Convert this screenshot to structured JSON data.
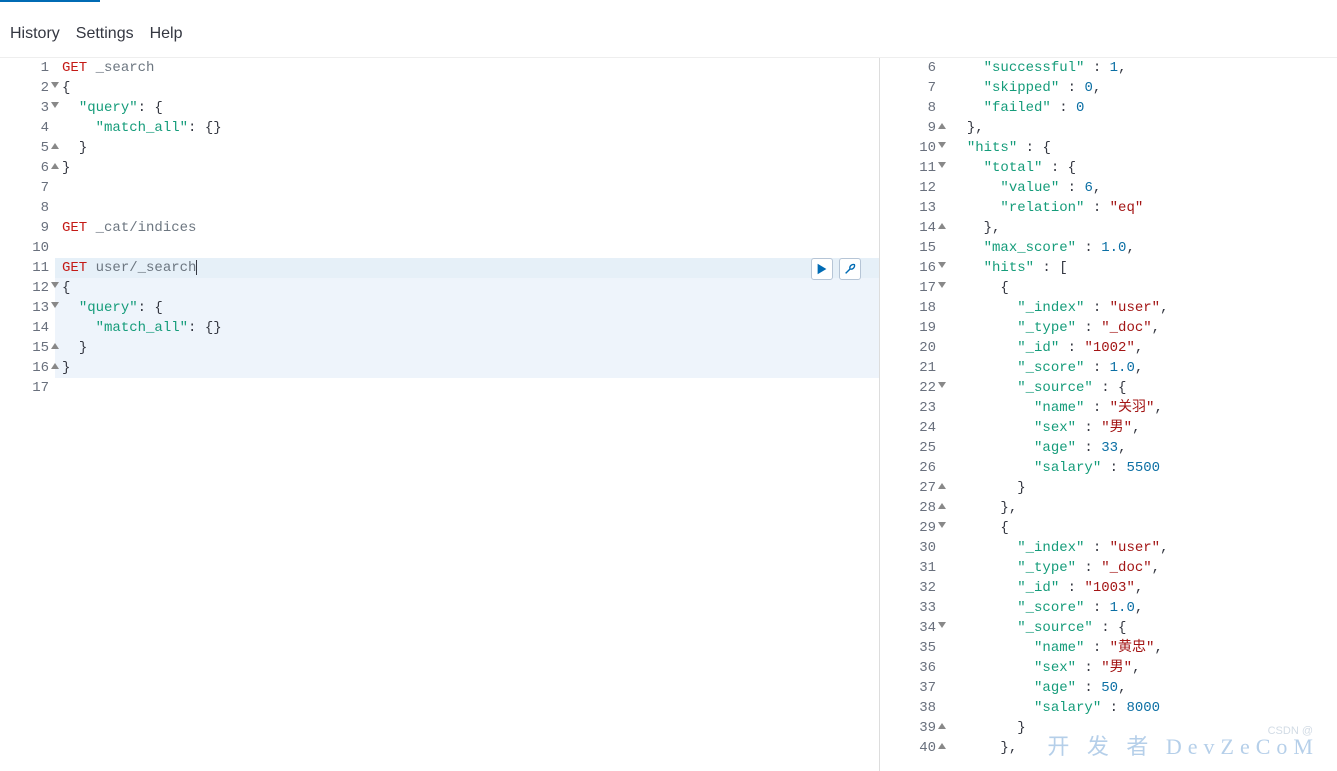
{
  "menubar": {
    "history": "History",
    "settings": "Settings",
    "help": "Help"
  },
  "editor": {
    "lines": [
      {
        "n": 1,
        "fold": "",
        "tokens": [
          [
            "method",
            "GET"
          ],
          [
            "plain",
            " "
          ],
          [
            "path",
            "_search"
          ]
        ]
      },
      {
        "n": 2,
        "fold": "open",
        "tokens": [
          [
            "punc",
            "{"
          ]
        ]
      },
      {
        "n": 3,
        "fold": "open",
        "tokens": [
          [
            "plain",
            "  "
          ],
          [
            "key",
            "\"query\""
          ],
          [
            "punc",
            ": {"
          ]
        ]
      },
      {
        "n": 4,
        "fold": "",
        "tokens": [
          [
            "plain",
            "    "
          ],
          [
            "key",
            "\"match_all\""
          ],
          [
            "punc",
            ": {}"
          ]
        ]
      },
      {
        "n": 5,
        "fold": "close",
        "tokens": [
          [
            "plain",
            "  "
          ],
          [
            "punc",
            "}"
          ]
        ]
      },
      {
        "n": 6,
        "fold": "close",
        "tokens": [
          [
            "punc",
            "}"
          ]
        ]
      },
      {
        "n": 7,
        "fold": "",
        "tokens": []
      },
      {
        "n": 8,
        "fold": "",
        "tokens": []
      },
      {
        "n": 9,
        "fold": "",
        "tokens": [
          [
            "method",
            "GET"
          ],
          [
            "plain",
            " "
          ],
          [
            "path",
            "_cat/indices"
          ]
        ]
      },
      {
        "n": 10,
        "fold": "",
        "tokens": []
      },
      {
        "n": 11,
        "fold": "",
        "tokens": [
          [
            "method",
            "GET"
          ],
          [
            "plain",
            " "
          ],
          [
            "path",
            "user/_search"
          ]
        ],
        "active": true,
        "cursor": true
      },
      {
        "n": 12,
        "fold": "open",
        "tokens": [
          [
            "punc",
            "{"
          ]
        ],
        "block": true
      },
      {
        "n": 13,
        "fold": "open",
        "tokens": [
          [
            "plain",
            "  "
          ],
          [
            "key",
            "\"query\""
          ],
          [
            "punc",
            ": {"
          ]
        ],
        "block": true
      },
      {
        "n": 14,
        "fold": "",
        "tokens": [
          [
            "plain",
            "    "
          ],
          [
            "key",
            "\"match_all\""
          ],
          [
            "punc",
            ": {}"
          ]
        ],
        "block": true
      },
      {
        "n": 15,
        "fold": "close",
        "tokens": [
          [
            "plain",
            "  "
          ],
          [
            "punc",
            "}"
          ]
        ],
        "block": true
      },
      {
        "n": 16,
        "fold": "close",
        "tokens": [
          [
            "punc",
            "}"
          ]
        ],
        "block": true
      },
      {
        "n": 17,
        "fold": "",
        "tokens": []
      }
    ]
  },
  "response": {
    "lines": [
      {
        "n": 6,
        "fold": "",
        "tokens": [
          [
            "plain",
            "    "
          ],
          [
            "key",
            "\"successful\""
          ],
          [
            "punc",
            " : "
          ],
          [
            "num",
            "1"
          ],
          [
            "punc",
            ","
          ]
        ]
      },
      {
        "n": 7,
        "fold": "",
        "tokens": [
          [
            "plain",
            "    "
          ],
          [
            "key",
            "\"skipped\""
          ],
          [
            "punc",
            " : "
          ],
          [
            "num",
            "0"
          ],
          [
            "punc",
            ","
          ]
        ]
      },
      {
        "n": 8,
        "fold": "",
        "tokens": [
          [
            "plain",
            "    "
          ],
          [
            "key",
            "\"failed\""
          ],
          [
            "punc",
            " : "
          ],
          [
            "num",
            "0"
          ]
        ]
      },
      {
        "n": 9,
        "fold": "close",
        "tokens": [
          [
            "plain",
            "  "
          ],
          [
            "punc",
            "},"
          ]
        ]
      },
      {
        "n": 10,
        "fold": "open",
        "tokens": [
          [
            "plain",
            "  "
          ],
          [
            "key",
            "\"hits\""
          ],
          [
            "punc",
            " : {"
          ]
        ]
      },
      {
        "n": 11,
        "fold": "open",
        "tokens": [
          [
            "plain",
            "    "
          ],
          [
            "key",
            "\"total\""
          ],
          [
            "punc",
            " : {"
          ]
        ]
      },
      {
        "n": 12,
        "fold": "",
        "tokens": [
          [
            "plain",
            "      "
          ],
          [
            "key",
            "\"value\""
          ],
          [
            "punc",
            " : "
          ],
          [
            "num",
            "6"
          ],
          [
            "punc",
            ","
          ]
        ]
      },
      {
        "n": 13,
        "fold": "",
        "tokens": [
          [
            "plain",
            "      "
          ],
          [
            "key",
            "\"relation\""
          ],
          [
            "punc",
            " : "
          ],
          [
            "str",
            "\"eq\""
          ]
        ]
      },
      {
        "n": 14,
        "fold": "close",
        "tokens": [
          [
            "plain",
            "    "
          ],
          [
            "punc",
            "},"
          ]
        ]
      },
      {
        "n": 15,
        "fold": "",
        "tokens": [
          [
            "plain",
            "    "
          ],
          [
            "key",
            "\"max_score\""
          ],
          [
            "punc",
            " : "
          ],
          [
            "num",
            "1.0"
          ],
          [
            "punc",
            ","
          ]
        ]
      },
      {
        "n": 16,
        "fold": "open",
        "tokens": [
          [
            "plain",
            "    "
          ],
          [
            "key",
            "\"hits\""
          ],
          [
            "punc",
            " : ["
          ]
        ]
      },
      {
        "n": 17,
        "fold": "open",
        "tokens": [
          [
            "plain",
            "      "
          ],
          [
            "punc",
            "{"
          ]
        ]
      },
      {
        "n": 18,
        "fold": "",
        "tokens": [
          [
            "plain",
            "        "
          ],
          [
            "key",
            "\"_index\""
          ],
          [
            "punc",
            " : "
          ],
          [
            "str",
            "\"user\""
          ],
          [
            "punc",
            ","
          ]
        ]
      },
      {
        "n": 19,
        "fold": "",
        "tokens": [
          [
            "plain",
            "        "
          ],
          [
            "key",
            "\"_type\""
          ],
          [
            "punc",
            " : "
          ],
          [
            "str",
            "\"_doc\""
          ],
          [
            "punc",
            ","
          ]
        ]
      },
      {
        "n": 20,
        "fold": "",
        "tokens": [
          [
            "plain",
            "        "
          ],
          [
            "key",
            "\"_id\""
          ],
          [
            "punc",
            " : "
          ],
          [
            "str",
            "\"1002\""
          ],
          [
            "punc",
            ","
          ]
        ]
      },
      {
        "n": 21,
        "fold": "",
        "tokens": [
          [
            "plain",
            "        "
          ],
          [
            "key",
            "\"_score\""
          ],
          [
            "punc",
            " : "
          ],
          [
            "num",
            "1.0"
          ],
          [
            "punc",
            ","
          ]
        ]
      },
      {
        "n": 22,
        "fold": "open",
        "tokens": [
          [
            "plain",
            "        "
          ],
          [
            "key",
            "\"_source\""
          ],
          [
            "punc",
            " : {"
          ]
        ]
      },
      {
        "n": 23,
        "fold": "",
        "tokens": [
          [
            "plain",
            "          "
          ],
          [
            "key",
            "\"name\""
          ],
          [
            "punc",
            " : "
          ],
          [
            "str",
            "\"关羽\""
          ],
          [
            "punc",
            ","
          ]
        ]
      },
      {
        "n": 24,
        "fold": "",
        "tokens": [
          [
            "plain",
            "          "
          ],
          [
            "key",
            "\"sex\""
          ],
          [
            "punc",
            " : "
          ],
          [
            "str",
            "\"男\""
          ],
          [
            "punc",
            ","
          ]
        ]
      },
      {
        "n": 25,
        "fold": "",
        "tokens": [
          [
            "plain",
            "          "
          ],
          [
            "key",
            "\"age\""
          ],
          [
            "punc",
            " : "
          ],
          [
            "num",
            "33"
          ],
          [
            "punc",
            ","
          ]
        ]
      },
      {
        "n": 26,
        "fold": "",
        "tokens": [
          [
            "plain",
            "          "
          ],
          [
            "key",
            "\"salary\""
          ],
          [
            "punc",
            " : "
          ],
          [
            "num",
            "5500"
          ]
        ]
      },
      {
        "n": 27,
        "fold": "close",
        "tokens": [
          [
            "plain",
            "        "
          ],
          [
            "punc",
            "}"
          ]
        ]
      },
      {
        "n": 28,
        "fold": "close",
        "tokens": [
          [
            "plain",
            "      "
          ],
          [
            "punc",
            "},"
          ]
        ]
      },
      {
        "n": 29,
        "fold": "open",
        "tokens": [
          [
            "plain",
            "      "
          ],
          [
            "punc",
            "{"
          ]
        ]
      },
      {
        "n": 30,
        "fold": "",
        "tokens": [
          [
            "plain",
            "        "
          ],
          [
            "key",
            "\"_index\""
          ],
          [
            "punc",
            " : "
          ],
          [
            "str",
            "\"user\""
          ],
          [
            "punc",
            ","
          ]
        ]
      },
      {
        "n": 31,
        "fold": "",
        "tokens": [
          [
            "plain",
            "        "
          ],
          [
            "key",
            "\"_type\""
          ],
          [
            "punc",
            " : "
          ],
          [
            "str",
            "\"_doc\""
          ],
          [
            "punc",
            ","
          ]
        ]
      },
      {
        "n": 32,
        "fold": "",
        "tokens": [
          [
            "plain",
            "        "
          ],
          [
            "key",
            "\"_id\""
          ],
          [
            "punc",
            " : "
          ],
          [
            "str",
            "\"1003\""
          ],
          [
            "punc",
            ","
          ]
        ]
      },
      {
        "n": 33,
        "fold": "",
        "tokens": [
          [
            "plain",
            "        "
          ],
          [
            "key",
            "\"_score\""
          ],
          [
            "punc",
            " : "
          ],
          [
            "num",
            "1.0"
          ],
          [
            "punc",
            ","
          ]
        ]
      },
      {
        "n": 34,
        "fold": "open",
        "tokens": [
          [
            "plain",
            "        "
          ],
          [
            "key",
            "\"_source\""
          ],
          [
            "punc",
            " : {"
          ]
        ]
      },
      {
        "n": 35,
        "fold": "",
        "tokens": [
          [
            "plain",
            "          "
          ],
          [
            "key",
            "\"name\""
          ],
          [
            "punc",
            " : "
          ],
          [
            "str",
            "\"黄忠\""
          ],
          [
            "punc",
            ","
          ]
        ]
      },
      {
        "n": 36,
        "fold": "",
        "tokens": [
          [
            "plain",
            "          "
          ],
          [
            "key",
            "\"sex\""
          ],
          [
            "punc",
            " : "
          ],
          [
            "str",
            "\"男\""
          ],
          [
            "punc",
            ","
          ]
        ]
      },
      {
        "n": 37,
        "fold": "",
        "tokens": [
          [
            "plain",
            "          "
          ],
          [
            "key",
            "\"age\""
          ],
          [
            "punc",
            " : "
          ],
          [
            "num",
            "50"
          ],
          [
            "punc",
            ","
          ]
        ]
      },
      {
        "n": 38,
        "fold": "",
        "tokens": [
          [
            "plain",
            "          "
          ],
          [
            "key",
            "\"salary\""
          ],
          [
            "punc",
            " : "
          ],
          [
            "num",
            "8000"
          ]
        ]
      },
      {
        "n": 39,
        "fold": "close",
        "tokens": [
          [
            "plain",
            "        "
          ],
          [
            "punc",
            "}"
          ]
        ]
      },
      {
        "n": 40,
        "fold": "close",
        "tokens": [
          [
            "plain",
            "      "
          ],
          [
            "punc",
            "},"
          ]
        ]
      }
    ]
  },
  "watermark": {
    "main": "开 发 者\nDevZeCoM",
    "sub": "CSDN @"
  }
}
